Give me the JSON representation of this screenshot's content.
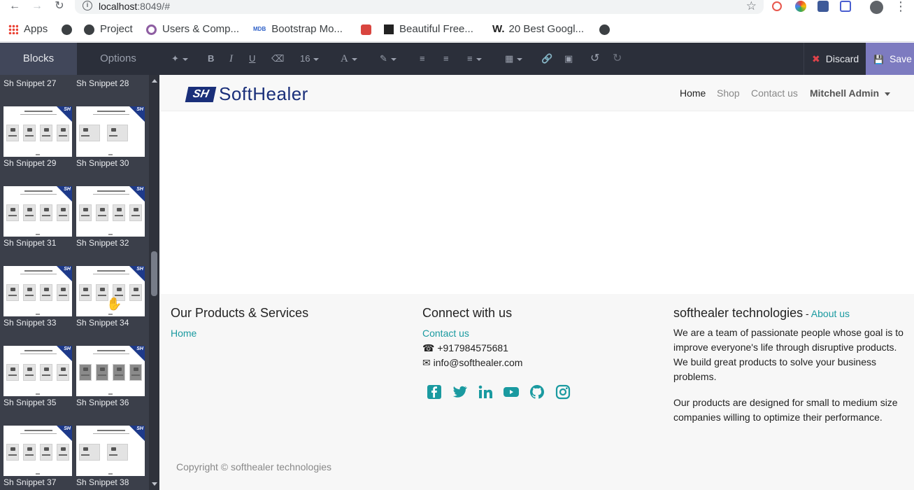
{
  "browser": {
    "url_host": "localhost",
    "url_rest": ":8049/#",
    "bookmarks": [
      {
        "label": "Apps"
      },
      {
        "label": ""
      },
      {
        "label": "Project"
      },
      {
        "label": "Users & Comp..."
      },
      {
        "label": "Bootstrap Mo..."
      },
      {
        "label": ""
      },
      {
        "label": "Beautiful Free..."
      },
      {
        "label": "20 Best Googl..."
      },
      {
        "label": ""
      }
    ],
    "mdb_badge": "MDB",
    "w_badge": "W."
  },
  "editor": {
    "tabs": [
      {
        "label": "Blocks"
      },
      {
        "label": "Options"
      }
    ],
    "font_size": "16",
    "discard_label": "Discard",
    "save_label": "Save"
  },
  "sidebar": {
    "snippets": [
      {
        "label": "Sh Snippet 27"
      },
      {
        "label": "Sh Snippet 28"
      },
      {
        "label": "Sh Snippet 29"
      },
      {
        "label": "Sh Snippet 30"
      },
      {
        "label": "Sh Snippet 31"
      },
      {
        "label": "Sh Snippet 32"
      },
      {
        "label": "Sh Snippet 33"
      },
      {
        "label": "Sh Snippet 34"
      },
      {
        "label": "Sh Snippet 35"
      },
      {
        "label": "Sh Snippet 36"
      },
      {
        "label": "Sh Snippet 37"
      },
      {
        "label": "Sh Snippet 38"
      }
    ],
    "badge": "SH"
  },
  "site": {
    "logo_mark": "SH",
    "logo_name": "SoftHealer",
    "nav": {
      "home": "Home",
      "shop": "Shop",
      "contact": "Contact us",
      "user": "Mitchell Admin"
    },
    "footer": {
      "products_title": "Our Products & Services",
      "products_home": "Home",
      "connect_title": "Connect with us",
      "connect_contact": "Contact us",
      "phone": "+917984575681",
      "email": "info@softhealer.com",
      "company_title": "softhealer technologies",
      "about_sep": " - ",
      "about_link": "About us",
      "para1": "We are a team of passionate people whose goal is to improve everyone's life through disruptive products. We build great products to solve your business problems.",
      "para2": "Our products are designed for small to medium size companies willing to optimize their performance.",
      "copyright": "Copyright © softhealer technologies"
    }
  },
  "colors": {
    "accent": "#1a9aa0",
    "brand": "#1a2f7a",
    "save": "#7d7bc0",
    "discard_x": "#e0434a"
  }
}
